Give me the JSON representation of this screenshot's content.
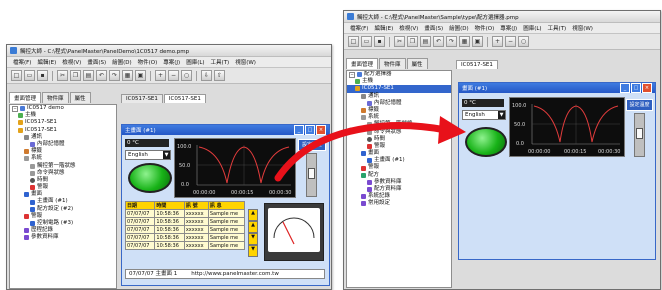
{
  "left_window": {
    "title": "觸控大師 - C:\\程式\\PanelMaster\\PanelDemo\\1C0517 demo.pmp",
    "menu": [
      "檔案(F)",
      "編輯(E)",
      "檢視(V)",
      "畫面(S)",
      "繪圖(D)",
      "物件(O)",
      "專案(J)",
      "圖庫(L)",
      "工具(T)",
      "視窗(W)"
    ],
    "left_tabs": [
      "畫面管理",
      "物件庫",
      "屬性"
    ],
    "doc_tabs": [
      "IC0517-SE1",
      "IC0517-SE1"
    ],
    "tree": [
      "IC0517 demo",
      "主機",
      "IC0517-SE1",
      "IC0517-SE1",
      "通訊",
      "內部記憶體",
      "標籤",
      "系統",
      "觸控第一階狀態",
      "命令與狀態",
      "時間",
      "警報",
      "畫面",
      "主畫面 (#1)",
      "配方設定 (#2)",
      "警報",
      "控制電路 (#3)",
      "歷程記錄",
      "參數資料庫"
    ],
    "screen_title": "主畫面 (#1)",
    "status_top": "0 °C",
    "language": "English",
    "chart": {
      "y_ticks": [
        "100.0",
        "50.0",
        "0.0"
      ],
      "x_ticks": [
        "00:00:00",
        "00:00:15",
        "00:00:30"
      ]
    },
    "side_label": "設定溫度",
    "table": {
      "headers": [
        "日期",
        "時間",
        "訊 號",
        "訊 息"
      ],
      "rows": [
        [
          "07/07/07",
          "10:58:36",
          "xxxxxx",
          "Sample me"
        ],
        [
          "07/07/07",
          "10:58:36",
          "xxxxxx",
          "Sample me"
        ],
        [
          "07/07/07",
          "10:58:36",
          "xxxxxx",
          "Sample me"
        ],
        [
          "07/07/07",
          "10:58:36",
          "xxxxxx",
          "Sample me"
        ],
        [
          "07/07/07",
          "10:58:36",
          "xxxxxx",
          "Sample me"
        ]
      ]
    },
    "status_bar": [
      "07/07/07 主畫面 1",
      "http://www.panelmaster.com.tw"
    ]
  },
  "right_window": {
    "title": "觸控大師 - C:\\程式\\PanelMaster\\Sample\\type\\配方選擇器.pmp",
    "menu": [
      "檔案(F)",
      "編輯(E)",
      "檢視(V)",
      "畫面(S)",
      "繪圖(D)",
      "物件(O)",
      "專案(J)",
      "圖庫(L)",
      "工具(T)",
      "視窗(W)"
    ],
    "left_tabs": [
      "畫面管理",
      "物件庫",
      "屬性"
    ],
    "doc_tabs": [
      "IC0517-SE1"
    ],
    "tree": [
      "配方選擇器",
      "主機",
      "IC0517-SE1",
      "通訊",
      "內部記憶體",
      "標籤",
      "系統",
      "觸控第一階狀態",
      "命令與狀態",
      "時間",
      "警報",
      "畫面",
      "主畫面 (#1)",
      "警報",
      "配方",
      "參數資料庫",
      "配方資料庫",
      "系統記錄",
      "常用設定"
    ],
    "screen_title": "畫面 (#1)",
    "status_top": "0 °C",
    "language": "English",
    "chart": {
      "y_ticks": [
        "100.0",
        "50.0",
        "0.0"
      ],
      "x_ticks": [
        "00:00:00",
        "00:00:15",
        "00:00:30"
      ]
    },
    "side_label": "設定溫度"
  },
  "colors": {
    "accent": "#e8111a",
    "inner_title": "#2f63d0",
    "green": "#1bb31b",
    "yellow": "#ffd400"
  }
}
